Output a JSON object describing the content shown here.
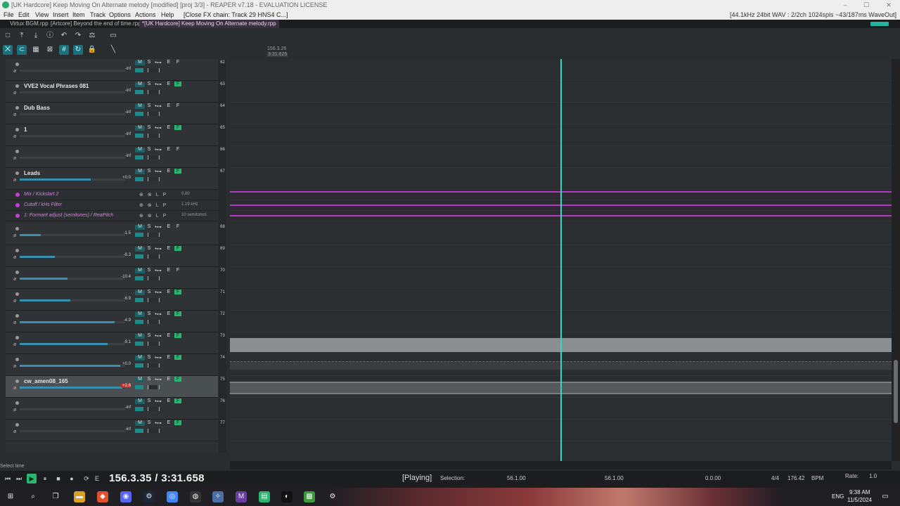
{
  "window": {
    "title": "[UK Hardcore] Keep Moving On Alternate melody [modified] [proj 3/3] - REAPER v7.18 - EVALUATION LICENSE",
    "min": "–",
    "max": "☐",
    "close": "✕"
  },
  "menu": {
    "items": [
      "File",
      "Edit",
      "View",
      "Insert",
      "Item",
      "Track",
      "Options",
      "Actions",
      "Help"
    ],
    "extra": "[Close FX chain: Track 29 HNS4 C...]",
    "audio_info": "[44.1kHz 24bit WAV : 2/2ch 1024spls ~43/187ms WaveOut]"
  },
  "tabs": [
    {
      "label": "Virtux BGM.rpp"
    },
    {
      "label": "[Artcore] Beyond the end of time.rpp"
    },
    {
      "label": "*[UK Hardcore] Keep Moving On Alternate melody.rpp"
    }
  ],
  "ruler": {
    "pos_beats": "156.3.26",
    "pos_time": "3:31.625"
  },
  "tracks": [
    {
      "num": "62",
      "name": "",
      "vol": "-inf",
      "fill": 0
    },
    {
      "num": "63",
      "name": "VVE2 Vocal Phrases 081",
      "vol": "-inf",
      "fill": 0
    },
    {
      "num": "64",
      "name": "Dub Bass",
      "vol": "-inf",
      "fill": 0
    },
    {
      "num": "65",
      "name": "1",
      "vol": "-inf",
      "fill": 0
    },
    {
      "num": "66",
      "name": "",
      "vol": "-inf",
      "fill": 0
    },
    {
      "num": "67",
      "name": "Leads",
      "vol": "+0.0",
      "fill": 0.67
    },
    {
      "num": "68",
      "name": "",
      "vol": "-1.5",
      "fill": 0.2
    },
    {
      "num": "69",
      "name": "",
      "vol": "-8.3",
      "fill": 0.33
    },
    {
      "num": "70",
      "name": "",
      "vol": "-10.4",
      "fill": 0.45
    },
    {
      "num": "71",
      "name": "",
      "vol": "-6.9",
      "fill": 0.48
    },
    {
      "num": "72",
      "name": "",
      "vol": "-4.9",
      "fill": 0.9
    },
    {
      "num": "73",
      "name": "",
      "vol": "-9.1",
      "fill": 0.83
    },
    {
      "num": "74",
      "name": "",
      "vol": "+0.0",
      "fill": 0.95
    },
    {
      "num": "75",
      "name": "cw_amen08_165",
      "vol": "+2.6",
      "fill": 0.97
    },
    {
      "num": "76",
      "name": "",
      "vol": "-inf",
      "fill": 0
    },
    {
      "num": "77",
      "name": "",
      "vol": "-inf",
      "fill": 0
    }
  ],
  "envelopes": [
    {
      "name": "Mix / Kickstart 2",
      "value": "0.80"
    },
    {
      "name": "Cutoff / kHs Filter",
      "value": "1.19 kHz"
    },
    {
      "name": "1: Formant adjust (semitones) / ReaPitch",
      "value": "10 semitones"
    }
  ],
  "track_buttons": {
    "m": "M",
    "s": "S",
    "io": "•⊶",
    "e": "E",
    "fx": "F"
  },
  "status": {
    "hint": "Select time"
  },
  "transport": {
    "time": "156.3.35 / 3:31.658",
    "state": "[Playing]",
    "selection_label": "Selection:",
    "sel_start": "56.1.00",
    "sel_end": "56.1.00",
    "sel_len": "0.0.00",
    "timesig": "4/4",
    "bpm": "176.42",
    "bpm_label": "BPM",
    "rate_label": "Rate:",
    "rate": "1.0"
  },
  "tray": {
    "lang": "ENG",
    "time": "9:38 AM",
    "date": "11/5/2024"
  },
  "colors": {
    "accent": "#36d6c2",
    "envelope": "#c23fd1",
    "fx_on": "#2bb573"
  }
}
